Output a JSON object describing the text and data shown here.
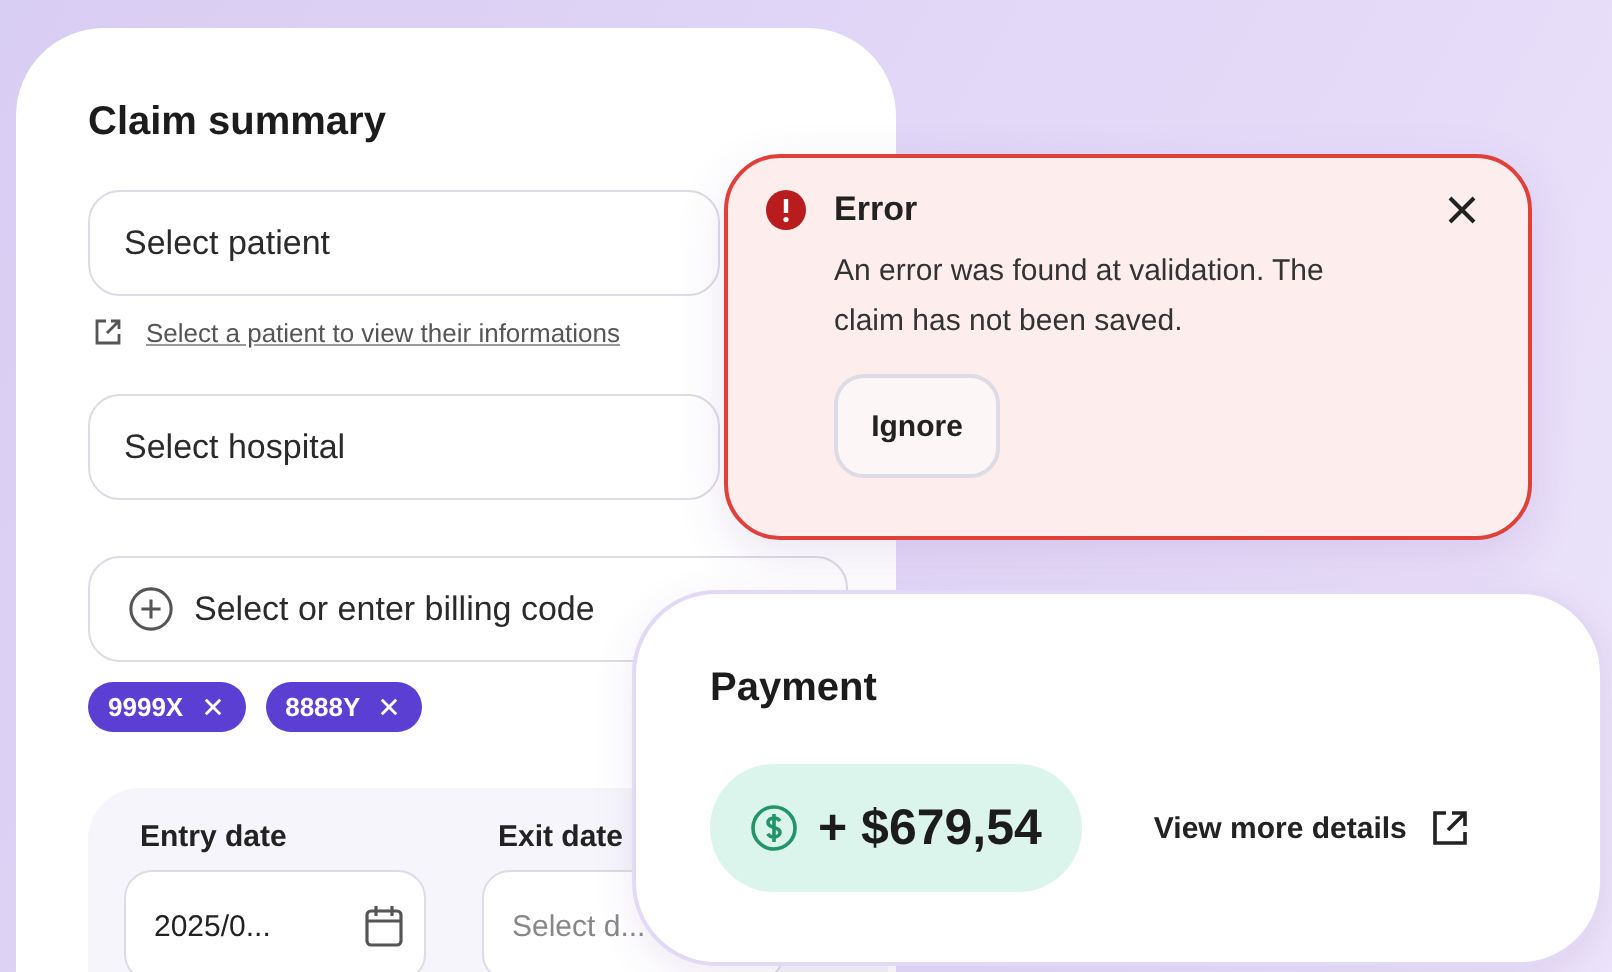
{
  "claim_summary": {
    "title": "Claim summary",
    "patient_field": {
      "placeholder": "Select patient"
    },
    "patient_link": "Select a patient to view their informations",
    "hospital_field": {
      "placeholder": "Select hospital"
    },
    "billing_field": {
      "placeholder": "Select or enter billing code"
    },
    "billing_codes": [
      {
        "label": "9999X"
      },
      {
        "label": "8888Y"
      }
    ],
    "dates": [
      {
        "label": "Entry date",
        "value": "2025/0..."
      },
      {
        "label": "Exit date",
        "placeholder": "Select d..."
      }
    ]
  },
  "error_alert": {
    "title": "Error",
    "message": "An error was found at validation. The claim has not been saved.",
    "buttons": [
      "Ignore"
    ]
  },
  "payment": {
    "title": "Payment",
    "amount": "+ $679,54",
    "link": "View more details"
  }
}
